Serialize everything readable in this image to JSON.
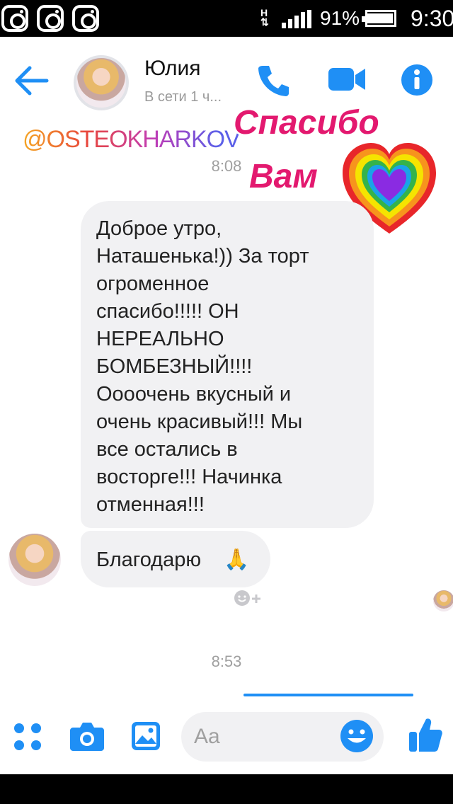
{
  "status_bar": {
    "network_type": "H",
    "battery_percent": "91%",
    "time": "9:30",
    "instagram_icons": [
      "instagram-icon",
      "instagram-icon",
      "instagram-icon"
    ]
  },
  "header": {
    "contact_name": "Юлия",
    "presence": "В сети 1 ч...",
    "icons": [
      "back-arrow-icon",
      "phone-icon",
      "video-camera-icon",
      "info-icon"
    ],
    "accent_color": "#1f8ff5"
  },
  "overlay": {
    "handle": "@OSTEOKHARKOV",
    "sticker_line1": "Спасибо",
    "sticker_line2": "Вам",
    "sticker_color": "#e3196f",
    "heart_icon": "rainbow-heart-icon"
  },
  "chat": {
    "timestamp_top": "8:08",
    "message_main": "Доброе утро, Наташенька!)) За торт огроменное спасибо!!!!! ОН НЕРЕАЛЬНО БОМБЕЗНЫЙ!!!! Оооочень вкусный и очень красивый!!! Мы все остались в восторге!!! Начинка отменная!!!",
    "message_lines": [
      "Доброе утро,",
      "Наташенька!)) За торт",
      "огроменное",
      "спасибо!!!!! ОН",
      "НЕРЕАЛЬНО",
      "БОМБЕЗНЫЙ!!!!",
      "Оооочень вкусный и",
      "очень красивый!!! Мы",
      "все остались в",
      "восторге!!! Начинка",
      "отменная!!!"
    ],
    "message_thanks": "Благодарю",
    "thanks_emoji": "🙏",
    "timestamp_bottom": "8:53",
    "bubble_color": "#f1f1f3"
  },
  "composer": {
    "placeholder": "Aa",
    "icons": [
      "apps-dots-icon",
      "camera-icon",
      "gallery-icon",
      "emoji-icon",
      "thumbs-up-icon"
    ]
  }
}
